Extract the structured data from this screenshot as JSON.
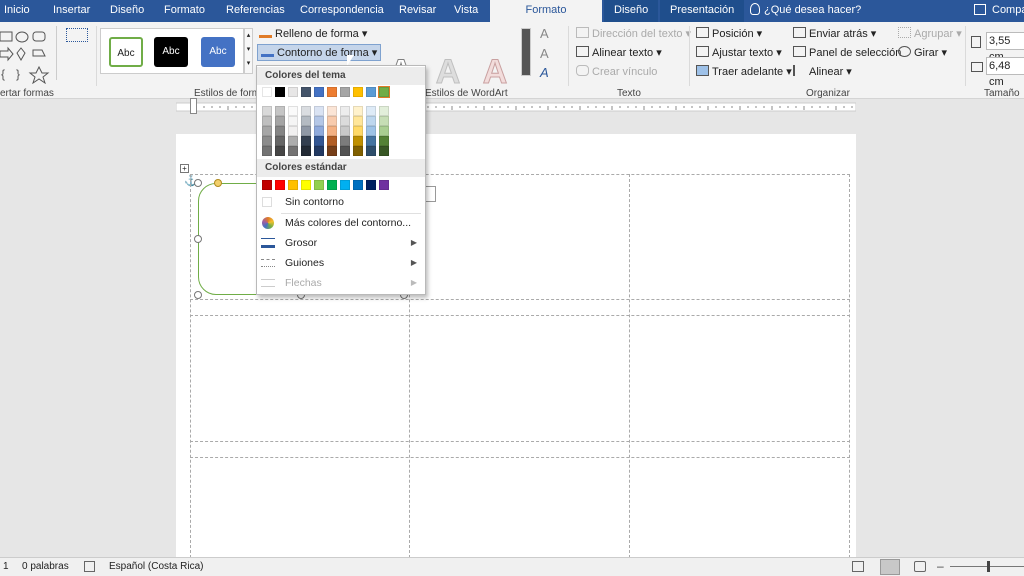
{
  "tabs": [
    {
      "label": "Inicio"
    },
    {
      "label": "Insertar"
    },
    {
      "label": "Diseño"
    },
    {
      "label": "Formato"
    },
    {
      "label": "Referencias"
    },
    {
      "label": "Correspondencia"
    },
    {
      "label": "Revisar"
    },
    {
      "label": "Vista"
    }
  ],
  "active_tab": "Formato",
  "context_tabs": [
    {
      "label": "Diseño"
    },
    {
      "label": "Presentación"
    }
  ],
  "tell_me": "¿Qué desea hacer?",
  "share_label": "Compa",
  "ribbon": {
    "insert_shapes_label": "ertar formas",
    "shape_styles_label": "Estilos de form",
    "style_samples": [
      "Abc",
      "Abc",
      "Abc"
    ],
    "fill_label": "Relleno de forma",
    "outline_label": "Contorno de forma",
    "wordart_label": "Estilos de WordArt",
    "wordart_letter": "A",
    "text_group": {
      "direction": "Dirección del texto",
      "align": "Alinear texto",
      "link": "Crear vínculo",
      "label": "Texto"
    },
    "arrange_group": {
      "position": "Posición",
      "wrap": "Ajustar texto",
      "bring_forward": "Traer adelante",
      "send_back": "Enviar atrás",
      "selection_pane": "Panel de selección",
      "align": "Alinear",
      "group": "Agrupar",
      "rotate": "Girar",
      "label": "Organizar"
    },
    "size_group": {
      "height": "3,55 cm",
      "width": "6,48 cm",
      "label": "Tamaño"
    }
  },
  "dropdown": {
    "theme_header": "Colores del tema",
    "standard_header": "Colores estándar",
    "no_outline": "Sin contorno",
    "more_colors": "Más colores del contorno...",
    "weight": "Grosor",
    "dashes": "Guiones",
    "arrows": "Flechas",
    "theme_top": [
      "#ffffff",
      "#000000",
      "#e7e6e6",
      "#44546a",
      "#4472c4",
      "#ed7d31",
      "#a5a5a5",
      "#ffc000",
      "#5b9bd5",
      "#70ad47"
    ],
    "standard": [
      "#c00000",
      "#ff0000",
      "#ffc000",
      "#ffff00",
      "#92d050",
      "#00b050",
      "#00b0f0",
      "#0070c0",
      "#002060",
      "#7030a0"
    ]
  },
  "status": {
    "page": "1",
    "words": "0 palabras",
    "language": "Español (Costa Rica)"
  }
}
